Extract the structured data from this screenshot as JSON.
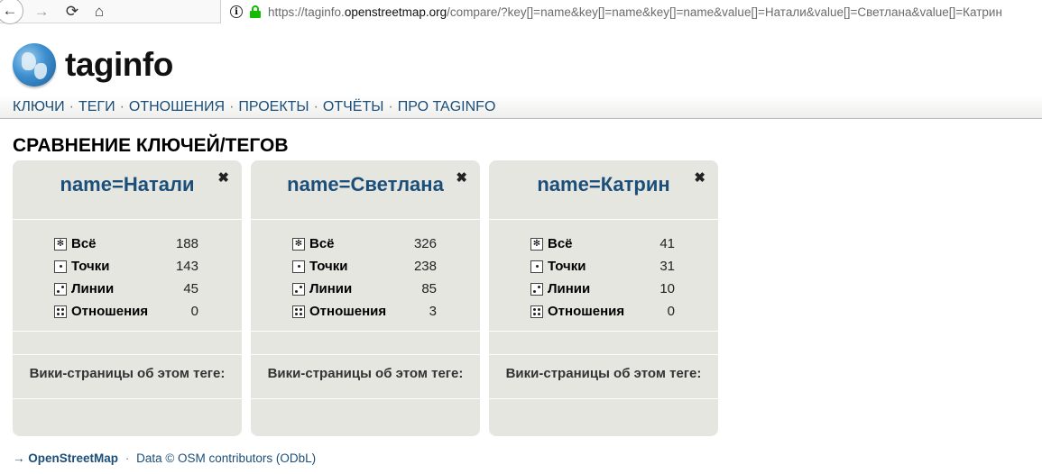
{
  "browser": {
    "url_prefix": "https://taginfo.",
    "url_host": "openstreetmap.org",
    "url_rest": "/compare/?key[]=name&key[]=name&key[]=name&value[]=Натали&value[]=Светлана&value[]=Катрин",
    "back_icon": "←",
    "forward_icon": "→",
    "reload_icon": "⟳",
    "home_icon": "⌂"
  },
  "logo": {
    "text": "taginfo"
  },
  "nav": {
    "items": [
      "КЛЮЧИ",
      "ТЕГИ",
      "ОТНОШЕНИЯ",
      "ПРОЕКТЫ",
      "ОТЧЁТЫ",
      "ПРО TAGINFO"
    ],
    "separator": "·"
  },
  "page_title": "СРАВНЕНИЕ КЛЮЧЕЙ/ТЕГОВ",
  "stat_labels": [
    "Всё",
    "Точки",
    "Линии",
    "Отношения"
  ],
  "wiki_label": "Вики-страницы об этом теге:",
  "close_glyph": "✖",
  "boxes": [
    {
      "key": "name",
      "eq": "=",
      "value": "Натали",
      "stats": [
        "188",
        "143",
        "45",
        "0"
      ]
    },
    {
      "key": "name",
      "eq": "=",
      "value": "Светлана",
      "stats": [
        "326",
        "238",
        "85",
        "3"
      ]
    },
    {
      "key": "name",
      "eq": "=",
      "value": "Катрин",
      "stats": [
        "41",
        "31",
        "10",
        "0"
      ]
    }
  ],
  "footer": {
    "arrow": "→",
    "osm_link": "OpenStreetMap",
    "sep": "·",
    "data_text": "Data © OSM contributors (ODbL)"
  }
}
